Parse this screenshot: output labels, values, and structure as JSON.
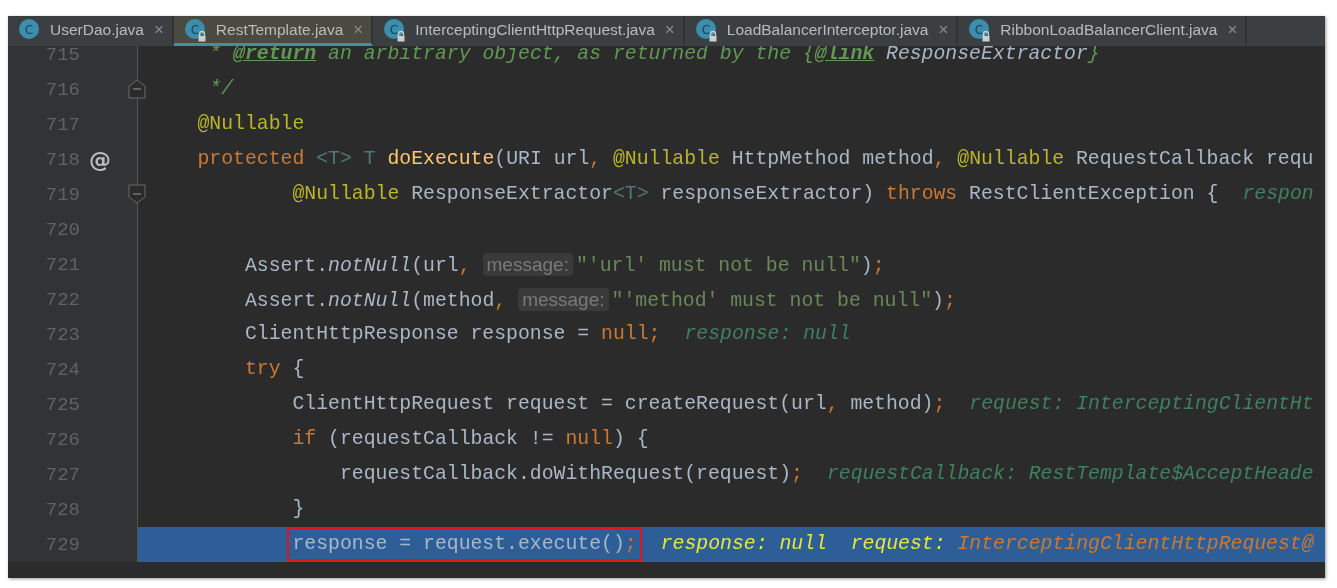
{
  "tabs": [
    {
      "icon": "C",
      "label": "UserDao.java",
      "locked": false,
      "selected": false,
      "close": "×"
    },
    {
      "icon": "C",
      "label": "RestTemplate.java",
      "locked": true,
      "selected": true,
      "close": "×"
    },
    {
      "icon": "C",
      "label": "InterceptingClientHttpRequest.java",
      "locked": true,
      "selected": false,
      "close": "×"
    },
    {
      "icon": "C",
      "label": "LoadBalancerInterceptor.java",
      "locked": true,
      "selected": false,
      "close": "×"
    },
    {
      "icon": "C",
      "label": "RibbonLoadBalancerClient.java",
      "locked": true,
      "selected": false,
      "close": "×"
    }
  ],
  "lines": [
    {
      "number": "715",
      "kind": "plain",
      "current": false,
      "outlined": false,
      "segments": [
        {
          "kind": "code",
          "tokens": [
            {
              "kind": "comment",
              "text": " * "
            },
            {
              "kind": "doctag",
              "text": "@return"
            },
            {
              "kind": "comment",
              "text": " an arbitrary object, as returned by the {"
            },
            {
              "kind": "doctag",
              "text": "@link"
            },
            {
              "kind": "docref",
              "text": " ResponseExtractor"
            },
            {
              "kind": "comment",
              "text": "}"
            }
          ]
        }
      ]
    },
    {
      "number": "716",
      "kind": "fold-end",
      "current": false,
      "outlined": false,
      "segments": [
        {
          "kind": "code",
          "tokens": [
            {
              "kind": "comment",
              "text": " */"
            }
          ]
        }
      ]
    },
    {
      "number": "717",
      "kind": "plain",
      "current": false,
      "outlined": false,
      "segments": [
        {
          "kind": "code",
          "tokens": [
            {
              "kind": "annotation",
              "text": "@Nullable"
            }
          ]
        }
      ]
    },
    {
      "number": "718",
      "kind": "plain",
      "current": false,
      "outlined": false,
      "gutter_mark": "@",
      "segments": [
        {
          "kind": "code",
          "tokens": [
            {
              "kind": "keyword",
              "text": "protected "
            },
            {
              "kind": "typeparam",
              "text": "<T>"
            },
            {
              "kind": "typeparam",
              "text": " T"
            },
            {
              "kind": "method",
              "text": " doExecute"
            },
            {
              "kind": "plain",
              "text": "(URI url"
            },
            {
              "kind": "punct",
              "text": ", "
            },
            {
              "kind": "annotation",
              "text": "@Nullable"
            },
            {
              "kind": "plain",
              "text": " HttpMethod method"
            },
            {
              "kind": "punct",
              "text": ", "
            },
            {
              "kind": "annotation",
              "text": "@Nullable"
            },
            {
              "kind": "plain",
              "text": " RequestCallback requ"
            }
          ]
        }
      ],
      "children": [
        {
          "number": "719",
          "kind": "fold-start",
          "current": false,
          "outlined": false,
          "segments": [
            {
              "kind": "code",
              "tokens": [
                {
                  "kind": "annotation",
                  "text": "    @Nullable"
                },
                {
                  "kind": "plain",
                  "text": " ResponseExtractor"
                },
                {
                  "kind": "typeparam",
                  "text": "<T>"
                },
                {
                  "kind": "plain",
                  "text": " responseExtractor) "
                },
                {
                  "kind": "keyword",
                  "text": "throws"
                },
                {
                  "kind": "plain",
                  "text": " RestClientException {"
                }
              ]
            },
            {
              "kind": "debug",
              "tokens": [
                {
                  "kind": "debug",
                  "text": "respon"
                }
              ]
            }
          ]
        },
        {
          "number": "720",
          "kind": "plain",
          "current": false,
          "outlined": false
        },
        {
          "number": "721",
          "kind": "plain",
          "current": false,
          "outlined": false,
          "segments": [
            {
              "kind": "code",
              "tokens": [
                {
                  "kind": "plain",
                  "text": "Assert."
                },
                {
                  "kind": "static",
                  "text": "notNull"
                },
                {
                  "kind": "plain",
                  "text": "(url"
                },
                {
                  "kind": "punct",
                  "text": ","
                }
              ]
            },
            {
              "kind": "hint",
              "text": "message:"
            },
            {
              "kind": "code",
              "tokens": [
                {
                  "kind": "string",
                  "text": "\"'url' must not be null\""
                },
                {
                  "kind": "plain",
                  "text": ")"
                },
                {
                  "kind": "punct",
                  "text": ";"
                }
              ]
            }
          ]
        },
        {
          "number": "722",
          "kind": "plain",
          "current": false,
          "outlined": false,
          "segments": [
            {
              "kind": "code",
              "tokens": [
                {
                  "kind": "plain",
                  "text": "Assert."
                },
                {
                  "kind": "static",
                  "text": "notNull"
                },
                {
                  "kind": "plain",
                  "text": "(method"
                },
                {
                  "kind": "punct",
                  "text": ","
                }
              ]
            },
            {
              "kind": "hint",
              "text": "message:"
            },
            {
              "kind": "code",
              "tokens": [
                {
                  "kind": "string",
                  "text": "\"'method' must not be null\""
                },
                {
                  "kind": "plain",
                  "text": ")"
                },
                {
                  "kind": "punct",
                  "text": ";"
                }
              ]
            }
          ]
        },
        {
          "number": "723",
          "kind": "plain",
          "current": false,
          "outlined": false,
          "segments": [
            {
              "kind": "code",
              "tokens": [
                {
                  "kind": "plain",
                  "text": "ClientHttpResponse response = "
                },
                {
                  "kind": "keyword",
                  "text": "null"
                },
                {
                  "kind": "punct",
                  "text": ";"
                }
              ]
            },
            {
              "kind": "debug",
              "tokens": [
                {
                  "kind": "debug",
                  "text": "response: null"
                }
              ]
            }
          ]
        },
        {
          "number": "724",
          "kind": "plain",
          "current": false,
          "outlined": false,
          "segments": [
            {
              "kind": "code",
              "tokens": [
                {
                  "kind": "keyword",
                  "text": "try"
                },
                {
                  "kind": "plain",
                  "text": " {"
                }
              ]
            }
          ],
          "children": [
            {
              "number": "725",
              "kind": "plain",
              "current": false,
              "outlined": false,
              "segments": [
                {
                  "kind": "code",
                  "tokens": [
                    {
                      "kind": "plain",
                      "text": "ClientHttpRequest request = createRequest(url"
                    },
                    {
                      "kind": "punct",
                      "text": ", "
                    },
                    {
                      "kind": "plain",
                      "text": "method)"
                    },
                    {
                      "kind": "punct",
                      "text": ";"
                    }
                  ]
                },
                {
                  "kind": "debug",
                  "tokens": [
                    {
                      "kind": "debug",
                      "text": "request: InterceptingClientHt"
                    }
                  ]
                }
              ]
            },
            {
              "number": "726",
              "kind": "plain",
              "current": false,
              "outlined": false,
              "segments": [
                {
                  "kind": "code",
                  "tokens": [
                    {
                      "kind": "keyword",
                      "text": "if"
                    },
                    {
                      "kind": "plain",
                      "text": " (requestCallback != "
                    },
                    {
                      "kind": "keyword",
                      "text": "null"
                    },
                    {
                      "kind": "plain",
                      "text": ") {"
                    }
                  ]
                }
              ],
              "children": [
                {
                  "number": "727",
                  "kind": "plain",
                  "current": false,
                  "outlined": false,
                  "segments": [
                    {
                      "kind": "code",
                      "tokens": [
                        {
                          "kind": "plain",
                          "text": "requestCallback.doWithRequest(request)"
                        },
                        {
                          "kind": "punct",
                          "text": ";"
                        }
                      ]
                    },
                    {
                      "kind": "debug",
                      "tokens": [
                        {
                          "kind": "debug",
                          "text": "requestCallback: RestTemplate$AcceptHeade"
                        }
                      ]
                    }
                  ]
                }
              ]
            },
            {
              "number": "728",
              "kind": "plain",
              "current": false,
              "outlined": false,
              "segments": [
                {
                  "kind": "code",
                  "tokens": [
                    {
                      "kind": "plain",
                      "text": "}"
                    }
                  ]
                }
              ]
            },
            {
              "number": "729",
              "kind": "plain",
              "current": true,
              "outlined": true,
              "segments": [
                {
                  "kind": "code",
                  "tokens": [
                    {
                      "kind": "plain",
                      "text": "response = request.execute()"
                    },
                    {
                      "kind": "punct",
                      "text": ";"
                    }
                  ]
                },
                {
                  "kind": "debug",
                  "tokens": [
                    {
                      "kind": "dkey",
                      "text": "response: null  request: "
                    },
                    {
                      "kind": "dval",
                      "text": "InterceptingClientHttpRequest@"
                    }
                  ]
                }
              ]
            }
          ]
        }
      ]
    }
  ]
}
